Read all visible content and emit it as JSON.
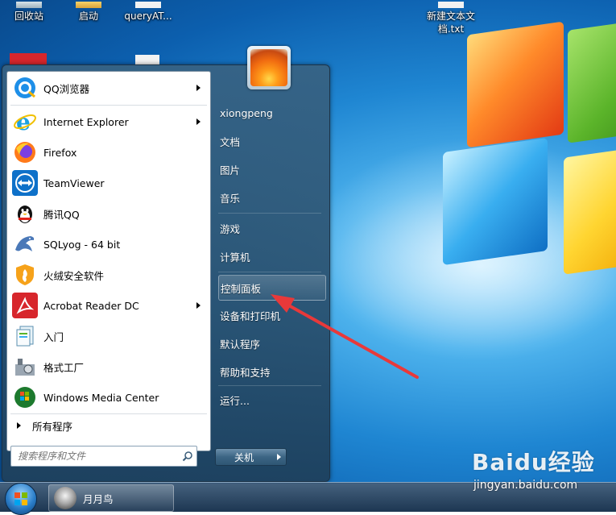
{
  "desktop": {
    "icons": [
      {
        "label": "回收站",
        "icon": "recycle-bin-icon"
      },
      {
        "label": "启动",
        "icon": "startup-icon"
      },
      {
        "label": "queryAT...",
        "icon": "file-icon"
      },
      {
        "label_line1": "新建文本文",
        "label_line2": "档.txt",
        "icon": "text-file-icon"
      }
    ]
  },
  "start_menu": {
    "programs": [
      {
        "label": "QQ浏览器",
        "icon": "qq-browser-icon",
        "submenu": true
      },
      {
        "label": "Internet Explorer",
        "icon": "internet-explorer-icon",
        "submenu": true
      },
      {
        "label": "Firefox",
        "icon": "firefox-icon",
        "submenu": false
      },
      {
        "label": "TeamViewer",
        "icon": "teamviewer-icon",
        "submenu": false
      },
      {
        "label": "腾讯QQ",
        "icon": "qq-penguin-icon",
        "submenu": false
      },
      {
        "label": "SQLyog - 64 bit",
        "icon": "sqlyog-dolphin-icon",
        "submenu": false
      },
      {
        "label": "火绒安全软件",
        "icon": "huorong-security-icon",
        "submenu": false
      },
      {
        "label": "Acrobat Reader DC",
        "icon": "acrobat-reader-icon",
        "submenu": true
      },
      {
        "label": "入门",
        "icon": "getting-started-icon",
        "submenu": false
      },
      {
        "label": "格式工厂",
        "icon": "format-factory-icon",
        "submenu": false
      },
      {
        "label": "Windows Media Center",
        "icon": "windows-media-center-icon",
        "submenu": false
      }
    ],
    "all_programs_label": "所有程序",
    "search_placeholder": "搜索程序和文件",
    "right_items": [
      {
        "label": "xiongpeng"
      },
      {
        "label": "文档"
      },
      {
        "label": "图片"
      },
      {
        "label": "音乐"
      },
      {
        "label": "游戏"
      },
      {
        "label": "计算机"
      },
      {
        "label": "控制面板"
      },
      {
        "label": "设备和打印机"
      },
      {
        "label": "默认程序"
      },
      {
        "label": "帮助和支持"
      },
      {
        "label": "运行..."
      }
    ],
    "shutdown_label": "关机"
  },
  "taskbar": {
    "task_label": "月月鸟"
  },
  "watermark": {
    "logo": "Baidu经验",
    "url": "jingyan.baidu.com"
  },
  "colors": {
    "annotation_arrow": "#e8393a"
  }
}
